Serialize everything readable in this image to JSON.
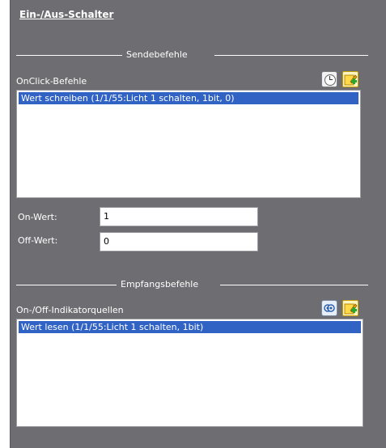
{
  "panel": {
    "title": "Ein-/Aus-Schalter"
  },
  "send_section": {
    "label": "Sendebefehle",
    "list_label": "OnClick-Befehle",
    "items": [
      "Wert schreiben (1/1/55:Licht 1 schalten, 1bit, 0)"
    ]
  },
  "fields": {
    "on_label": "On-Wert:",
    "on_value": "1",
    "off_label": "Off-Wert:",
    "off_value": "0"
  },
  "receive_section": {
    "label": "Empfangsbefehle",
    "list_label": "On-/Off-Indikatorquellen",
    "items": [
      "Wert lesen (1/1/55:Licht 1 schalten, 1bit)"
    ]
  },
  "icons": {
    "clock": "clock-icon",
    "add": "add-command-icon",
    "eye": "view-icon"
  },
  "colors": {
    "panel_bg": "#6e6e72",
    "selection": "#3163c5"
  }
}
